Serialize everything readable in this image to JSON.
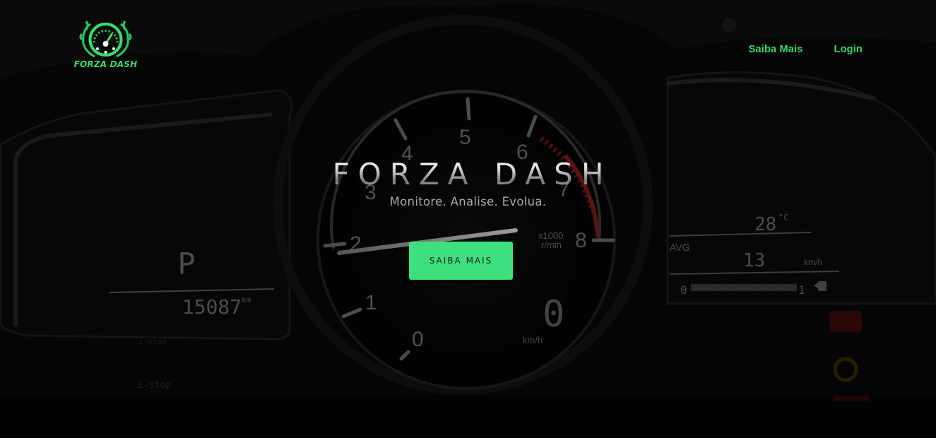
{
  "brand": {
    "logo_text": "FORZA DASH"
  },
  "nav": {
    "items": [
      {
        "label": "Saiba Mais"
      },
      {
        "label": "Login"
      }
    ]
  },
  "hero": {
    "title": "FORZA DASH",
    "subtitle": "Monitore. Analise. Evolua.",
    "cta_label": "SAIBA MAIS"
  },
  "dashboard": {
    "gear": "P",
    "odometer": "15087",
    "odometer_unit": "km",
    "temperature": "28",
    "temperature_unit": "°C",
    "avg_label": "AVG",
    "avg_speed": "13",
    "avg_unit": "km/h",
    "fuel_min": "0",
    "fuel_max": "1",
    "tach_numbers": [
      "0",
      "1",
      "2",
      "3",
      "4",
      "5",
      "6",
      "7",
      "8"
    ],
    "tach_unit_top": "x1000",
    "tach_unit_bottom": "r/min",
    "speed": "0",
    "speed_unit": "km/h",
    "istop_label": "i-stop",
    "istop_small": "i-stop"
  },
  "colors": {
    "accent": "#3ee07e",
    "nav_text": "#35d96e",
    "background": "#070707",
    "redline": "#c42a22"
  },
  "icons": [
    "speedometer-logo-icon",
    "fuel-pump-icon",
    "warning-light-icon"
  ]
}
